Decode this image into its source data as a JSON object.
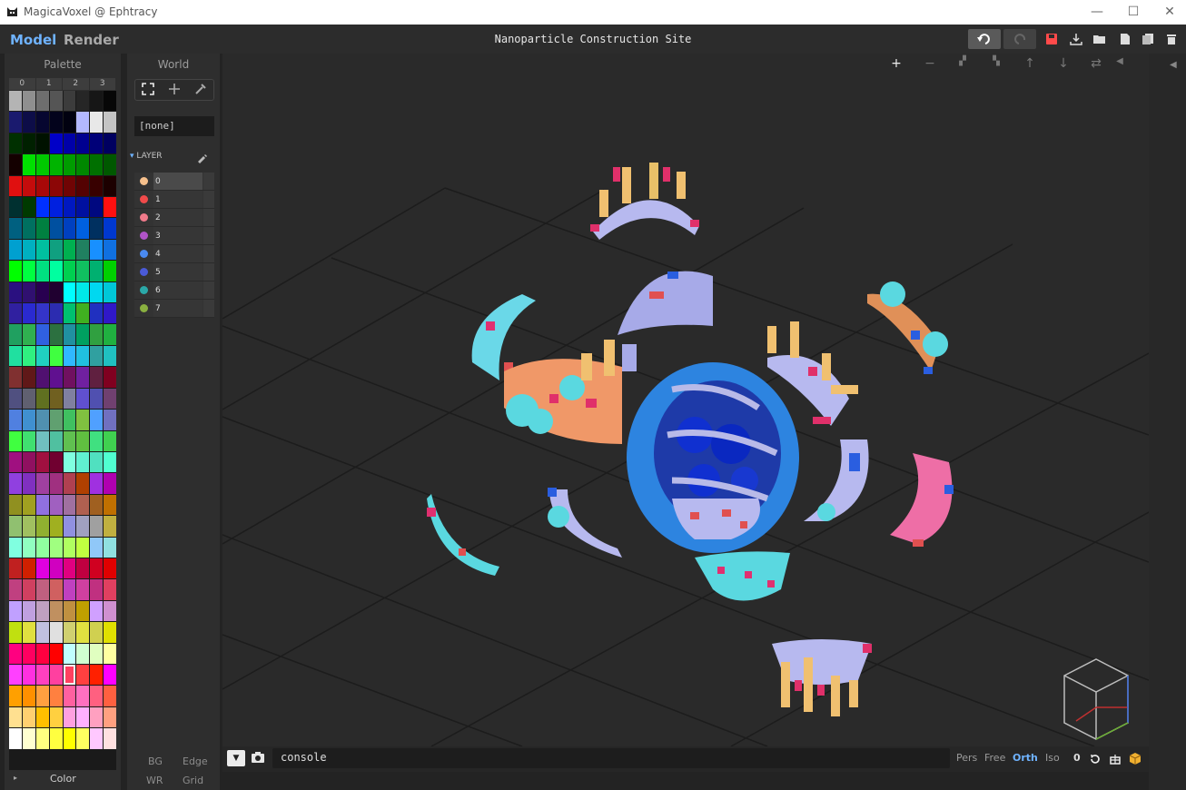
{
  "window": {
    "title": "MagicaVoxel @ Ephtracy"
  },
  "topbar": {
    "mode_model": "Model",
    "mode_render": "Render",
    "project_title": "Nanoparticle Construction Site"
  },
  "palette": {
    "header": "Palette",
    "tabs": [
      "0",
      "1",
      "2",
      "3"
    ],
    "selected_index": 220,
    "footer_label": "Color",
    "colors": [
      "#b4b4b4",
      "#8f8f8f",
      "#6e6e6e",
      "#555555",
      "#3c3c3c",
      "#262626",
      "#161616",
      "#070707",
      "#1a1a6e",
      "#0d0d48",
      "#060630",
      "#03031c",
      "#010110",
      "#b3b8ff",
      "#e8e8e8",
      "#c4c4c4",
      "#003000",
      "#002000",
      "#001200",
      "#0000c8",
      "#0000a8",
      "#000090",
      "#000078",
      "#000060",
      "#140000",
      "#00e000",
      "#00c800",
      "#00b400",
      "#009c00",
      "#008800",
      "#007000",
      "#005800",
      "#e01010",
      "#c40c0c",
      "#a80808",
      "#8c0606",
      "#700404",
      "#540202",
      "#380000",
      "#1c0000",
      "#003030",
      "#003a00",
      "#0030ff",
      "#0020e0",
      "#0018c0",
      "#0010a0",
      "#000880",
      "#ff1010",
      "#006080",
      "#007060",
      "#008040",
      "#0050a0",
      "#0040c0",
      "#0060e0",
      "#003060",
      "#0038d0",
      "#00a0d0",
      "#00b0c0",
      "#00c0a0",
      "#10a080",
      "#00b050",
      "#208060",
      "#1890ff",
      "#1070e0",
      "#00ff00",
      "#00ff40",
      "#00e080",
      "#00ffa0",
      "#00d050",
      "#10c060",
      "#00b070",
      "#00d000",
      "#2a1080",
      "#301070",
      "#280050",
      "#200030",
      "#00ffff",
      "#00e8e8",
      "#00d8f0",
      "#00c8d8",
      "#3020a0",
      "#2a2ad0",
      "#3434c8",
      "#2c2cb0",
      "#00c070",
      "#40b020",
      "#2030c0",
      "#3018c8",
      "#20a060",
      "#30b050",
      "#3060e0",
      "#2c7040",
      "#2090a0",
      "#00a060",
      "#30a040",
      "#20b040",
      "#20e0a0",
      "#30f080",
      "#20d0c0",
      "#40ff40",
      "#30b8ff",
      "#20c0e0",
      "#30a0a0",
      "#20c0c0",
      "#803030",
      "#601818",
      "#501070",
      "#601090",
      "#701060",
      "#7020a0",
      "#602040",
      "#800020",
      "#505080",
      "#606070",
      "#607020",
      "#706020",
      "#8080a0",
      "#6050d0",
      "#5050b0",
      "#704070",
      "#5080e0",
      "#4090d0",
      "#5090b0",
      "#60a070",
      "#40c060",
      "#80c040",
      "#50a0ff",
      "#7070c0",
      "#40ff40",
      "#40e070",
      "#70c0c0",
      "#50c0a0",
      "#60c050",
      "#60c040",
      "#40e080",
      "#40d050",
      "#a01080",
      "#901060",
      "#a01040",
      "#700030",
      "#80ffe0",
      "#60f0d0",
      "#50e0c0",
      "#50ffd0",
      "#9040e0",
      "#8030c0",
      "#a040a0",
      "#a03080",
      "#b04050",
      "#b04000",
      "#a030e0",
      "#b000b0",
      "#909020",
      "#a0a020",
      "#9070e0",
      "#a060c0",
      "#a070a0",
      "#b06050",
      "#a06020",
      "#c07000",
      "#90c070",
      "#a0c060",
      "#90b030",
      "#a0b020",
      "#9090e0",
      "#a0a0c0",
      "#a0a0a0",
      "#c0b040",
      "#80ffe0",
      "#90ffc0",
      "#90ffa0",
      "#a0ff80",
      "#b0ff60",
      "#c0ff40",
      "#90c8f8",
      "#90e0e0",
      "#c02020",
      "#d02000",
      "#e000e0",
      "#d000c0",
      "#e00080",
      "#c00040",
      "#d00020",
      "#e00000",
      "#c04080",
      "#d04060",
      "#c06080",
      "#d06060",
      "#c040c0",
      "#d040a0",
      "#c03080",
      "#e04060",
      "#c0a0ff",
      "#c0a0e0",
      "#c0a0c0",
      "#c09060",
      "#c09040",
      "#c0a000",
      "#d0a0ff",
      "#d090d0",
      "#c0e010",
      "#e0e040",
      "#c0c0e0",
      "#e0e0e0",
      "#d0d070",
      "#e0e040",
      "#d0d050",
      "#e0e000",
      "#ff0080",
      "#ff0060",
      "#ff0040",
      "#ff0000",
      "#c0ffff",
      "#d0ffd0",
      "#e0ffc0",
      "#ffffa0",
      "#ff40ff",
      "#ff30e0",
      "#ff40c0",
      "#ff40a0",
      "#ff4060",
      "#ff4040",
      "#ff2000",
      "#ff00ff",
      "#ffa000",
      "#ff9000",
      "#ffa040",
      "#ff8040",
      "#ff60a0",
      "#ff70c0",
      "#ff6080",
      "#ff6040",
      "#ffe090",
      "#ffd070",
      "#ffc000",
      "#ffd040",
      "#ffa0e0",
      "#ffb0ff",
      "#ffa0c0",
      "#ffa080",
      "#ffffff",
      "#ffffd0",
      "#ffff80",
      "#ffff40",
      "#ffff00",
      "#ffff60",
      "#ffc8ff",
      "#ffe0e0"
    ]
  },
  "world": {
    "header": "World",
    "tool_icons": [
      "select-icon",
      "move-icon",
      "pick-icon"
    ],
    "object_name": "[none]",
    "layer_header": "LAYER",
    "layers": [
      {
        "name": "0",
        "color": "#f6c08c"
      },
      {
        "name": "1",
        "color": "#f04a4a"
      },
      {
        "name": "2",
        "color": "#f07a8a"
      },
      {
        "name": "3",
        "color": "#b054c8"
      },
      {
        "name": "4",
        "color": "#4a8af0"
      },
      {
        "name": "5",
        "color": "#4a5ad8"
      },
      {
        "name": "6",
        "color": "#2aa8a8"
      },
      {
        "name": "7",
        "color": "#8ab040"
      }
    ],
    "footer": {
      "bg": "BG",
      "edge": "Edge",
      "wr": "WR",
      "grid": "Grid"
    }
  },
  "console": {
    "value": "console",
    "modes": [
      "Pers",
      "Free",
      "Orth",
      "Iso"
    ],
    "active_mode": "Orth",
    "count": "0"
  },
  "accent_color": "#6fb3ff"
}
